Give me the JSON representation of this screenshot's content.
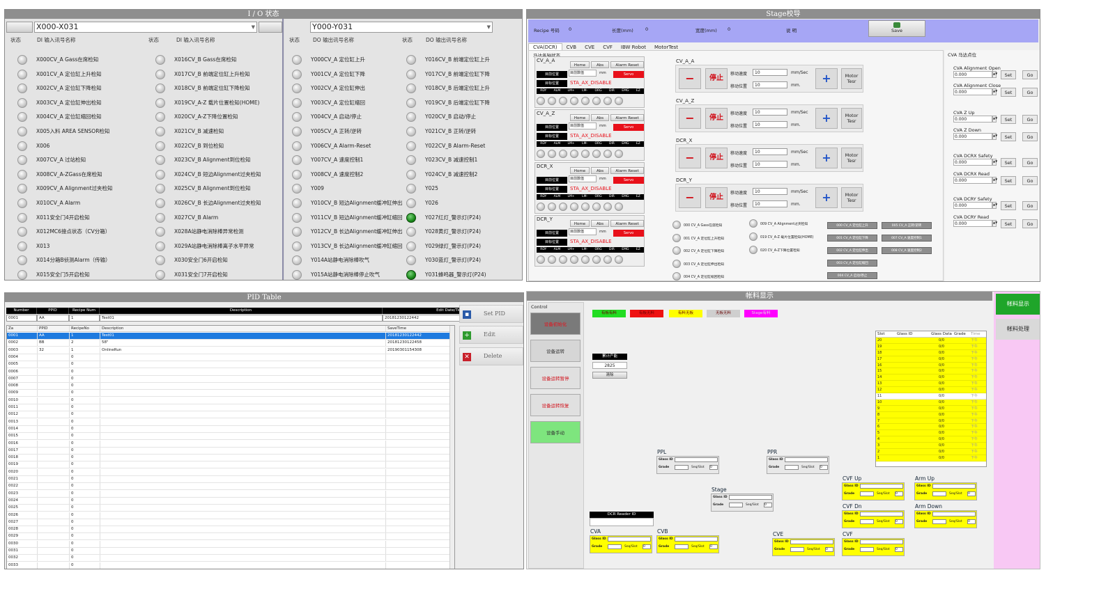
{
  "io": {
    "title": "I / O 状态",
    "di_select": "X000-X031",
    "do_select": "Y000-Y031",
    "h_state": "状态",
    "h_di_name": "DI 输入讯号名称",
    "h_do_name": "DO 输出讯号名称",
    "di_left": [
      "X000CV_A Gass在席检知",
      "X001CV_A 定位缸上升检知",
      "X002CV_A 定位缸下降检知",
      "X003CV_A 定位缸伸出检知",
      "X004CV_A 定位缸缩回检知",
      "X005入料 AREA SENSOR检知",
      "X006",
      "X007CV_A 过站检知",
      "X008CV_A-ZGass在席检知",
      "X009CV_A Alignment过夹检知",
      "X010CV_A Alarm",
      "X011安全门4开启检知",
      "X012MC6接点状态（CV分箱）",
      "X013",
      "X014分箱B侦测Alarm（传输）",
      "X015安全门5开启检知"
    ],
    "di_right": [
      "X016CV_B Gass在席检知",
      "X017CV_B 前端定位缸上升检知",
      "X018CV_B 前端定位缸下降检知",
      "X019CV_A-Z 载片位置检知(HOME)",
      "X020CV_A-Z下降位置检知",
      "X021CV_B 减速检知",
      "X022CV_B 到位检知",
      "X023CV_B Alignment到位检知",
      "X024CV_B 短边Alignment过夹检知",
      "X025CV_B Alignment到位检知",
      "X026CV_B 长边Alignment过夹检知",
      "X027CV_B Alarm",
      "X028A站静电消除棒异常检测",
      "X029A站静电消除棒离子水平异常",
      "X030安全门6开启检知",
      "X031安全门7开启检知"
    ],
    "do_left": [
      "Y000CV_A 定位缸上升",
      "Y001CV_A 定位缸下降",
      "Y002CV_A 定位缸伸出",
      "Y003CV_A 定位缸缩回",
      "Y004CV_A 启动/停止",
      "Y005CV_A 正转/逆转",
      "Y006CV_A Alarm-Reset",
      "Y007CV_A 速度控制1",
      "Y008CV_A 速度控制2",
      "Y009",
      "Y010CV_B 短边Alignment缓冲缸伸出",
      "Y011CV_B 短边Alignment缓冲缸缩回",
      "Y012CV_B 长边Alignment缓冲缸伸出",
      "Y013CV_B 长边Alignment缓冲缸缩回",
      "Y014A站静电消除棒吹气",
      "Y015A站静电消除棒停止吹气"
    ],
    "do_right": [
      "Y016CV_B 前端定位缸上升",
      "Y017CV_B 前端定位缸下降",
      "Y018CV_B 后端定位缸上升",
      "Y019CV_B 后端定位缸下降",
      "Y020CV_B 启动/停止",
      "Y021CV_B 正转/逆转",
      "Y022CV_B Alarm-Reset",
      "Y023CV_B 减速控制1",
      "Y024CV_B 减速控制2",
      "Y025",
      "Y026",
      "Y027红灯_警示灯(P24)",
      "Y028黄灯_警示灯(P24)",
      "Y029绿灯_警示灯(P24)",
      "Y030蓝灯_警示灯(P24)",
      "Y031蜂鸣器_警示灯(P24)"
    ]
  },
  "stage": {
    "title": "Stage校导",
    "recipe_label": "Recipe 号码",
    "recipe_val": "0",
    "len_label": "长度(mm)",
    "len_val": "0",
    "wid_label": "宽度(mm)",
    "wid_val": "0",
    "note_label": "说 明",
    "save": "Save",
    "tabs": [
      "CVA(DCR)",
      "CVB",
      "CVE",
      "CVF",
      "IBW Robot",
      "MotorTest"
    ],
    "axis_group": "马达各轴状态",
    "axes": [
      {
        "name": "CV_A_A"
      },
      {
        "name": "CV_A_Z"
      },
      {
        "name": "DCR_X"
      },
      {
        "name": "DCR_Y"
      }
    ],
    "home": "Home",
    "abs": "Abs",
    "alarm_reset": "Alarm Reset",
    "cur_pos": "目前位置",
    "cmd": "目标位置",
    "pos_val": "0",
    "mm": "mm",
    "servo": "Servo",
    "disable": "STA_AX_DISABLE",
    "jump": "目前数值",
    "strip": [
      "RDY",
      "ALM",
      "LM+",
      "LM-",
      "ORG",
      "DIR",
      "EMG",
      "EZ"
    ],
    "moves": [
      {
        "name": "CV_A_A"
      },
      {
        "name": "CV_A_Z"
      },
      {
        "name": "DCR_X"
      },
      {
        "name": "DCR_Y"
      }
    ],
    "speed_lbl": "移动速度",
    "dist_lbl": "移动位置",
    "speed_val": "10",
    "dist_val": "10",
    "unit_speed": "mm/Sec",
    "unit_dist": "mm.",
    "stop": "停止",
    "motor_test": "Motor Tesr",
    "sig_left": [
      "000 CV_A Gass在席检知",
      "001 CV_A 定位缸上升检知",
      "002 CV_A 定位缸下降检知",
      "003 CV_A 定位缸伸出检知",
      "004 CV_A 定位缸缩回检知"
    ],
    "sig_mid": [
      "009 CV_A Alignment过夹检知",
      "019 CV_A-Z 载片位置检知(HOME)",
      "020 CV_A-Z下降位置检知"
    ],
    "btn_a": [
      "000 CV_A 定位缸上升",
      "001 CV_A 定位缸下降",
      "002 CV_A 定位缸伸出",
      "003 CV_A 定位缸缩回",
      "004 CV_A 启动/停止"
    ],
    "btn_b": [
      "005 CV_A 正转/逆转",
      "007 CV_A 速度控制1",
      "008 CV_A 速度控制2"
    ],
    "cva_title": "CVA 马达点位",
    "points": [
      {
        "label": "CVA Alignment Open",
        "val": "0.000"
      },
      {
        "label": "CVA Alignment Close",
        "val": "0.000"
      },
      {
        "label": "CVA Z Up",
        "val": "0.000"
      },
      {
        "label": "CVA Z Down",
        "val": "0.000"
      },
      {
        "label": "CVA DCRX Safety",
        "val": "0.000"
      },
      {
        "label": "CVA DCRX Read",
        "val": "0.000"
      },
      {
        "label": "CVA DCRY Safety",
        "val": "0.000"
      },
      {
        "label": "CVA DCRY Read",
        "val": "0.000"
      }
    ],
    "set": "Set",
    "go": "Go"
  },
  "pid": {
    "title": "PID Table",
    "hdr": [
      "Number",
      "PPID",
      "Recipe Num",
      "Description",
      "Edit Date/Time"
    ],
    "inputs": [
      "0001",
      "AA",
      "1",
      "Test01",
      "20181230122442"
    ],
    "cols": [
      "Za",
      "PPID",
      "RecipeNo",
      "Description",
      "SaveTime"
    ],
    "rows": [
      [
        "0001",
        "AA",
        "1",
        "Test01",
        "20181230122442"
      ],
      [
        "0002",
        "BB",
        "2",
        "58\"",
        "20181230122458"
      ],
      [
        "0003",
        "32",
        "1",
        "OnlineRun",
        "20190301154308"
      ],
      [
        "0004",
        "",
        "0",
        "",
        ""
      ],
      [
        "0005",
        "",
        "0",
        "",
        ""
      ],
      [
        "0006",
        "",
        "0",
        "",
        ""
      ],
      [
        "0007",
        "",
        "0",
        "",
        ""
      ],
      [
        "0008",
        "",
        "0",
        "",
        ""
      ],
      [
        "0009",
        "",
        "0",
        "",
        ""
      ],
      [
        "0010",
        "",
        "0",
        "",
        ""
      ],
      [
        "0011",
        "",
        "0",
        "",
        ""
      ],
      [
        "0012",
        "",
        "0",
        "",
        ""
      ],
      [
        "0013",
        "",
        "0",
        "",
        ""
      ],
      [
        "0014",
        "",
        "0",
        "",
        ""
      ],
      [
        "0015",
        "",
        "0",
        "",
        ""
      ],
      [
        "0016",
        "",
        "0",
        "",
        ""
      ],
      [
        "0017",
        "",
        "0",
        "",
        ""
      ],
      [
        "0018",
        "",
        "0",
        "",
        ""
      ],
      [
        "0019",
        "",
        "0",
        "",
        ""
      ],
      [
        "0020",
        "",
        "0",
        "",
        ""
      ],
      [
        "0021",
        "",
        "0",
        "",
        ""
      ],
      [
        "0022",
        "",
        "0",
        "",
        ""
      ],
      [
        "0023",
        "",
        "0",
        "",
        ""
      ],
      [
        "0024",
        "",
        "0",
        "",
        ""
      ],
      [
        "0025",
        "",
        "0",
        "",
        ""
      ],
      [
        "0026",
        "",
        "0",
        "",
        ""
      ],
      [
        "0027",
        "",
        "0",
        "",
        ""
      ],
      [
        "0028",
        "",
        "0",
        "",
        ""
      ],
      [
        "0029",
        "",
        "0",
        "",
        ""
      ],
      [
        "0030",
        "",
        "0",
        "",
        ""
      ],
      [
        "0031",
        "",
        "0",
        "",
        ""
      ],
      [
        "0032",
        "",
        "0",
        "",
        ""
      ],
      [
        "0033",
        "",
        "0",
        "",
        ""
      ]
    ],
    "set_pid": "Set PID",
    "edit": "Edit",
    "delete": "Delete"
  },
  "acct": {
    "title": "帐料显示",
    "control": "Control",
    "ctl": [
      "设备初始化",
      "设备运转",
      "设备运转暂停",
      "设备运转恢复",
      "设备手动"
    ],
    "legend": [
      "有板有料",
      "有板无料",
      "有料无板",
      "无板无料",
      "Stage有料"
    ],
    "counter_label": "累计产能",
    "counter_val": "2825",
    "clear": "清除",
    "slot_hdr": [
      "Slot",
      "Glass ID",
      "Glass Data",
      "Grade",
      "Time"
    ],
    "slots": [
      "20",
      "19",
      "18",
      "17",
      "16",
      "15",
      "14",
      "13",
      "12",
      "11",
      "10",
      "9",
      "8",
      "7",
      "6",
      "5",
      "4",
      "3",
      "2",
      "1"
    ],
    "slot_data": "0/0",
    "slot_time": "下午",
    "dcr": "DCR Reader ID",
    "glass_lbl": "Glass ID",
    "grade_lbl": "Grade",
    "seq_lbl": "Seq/Slot",
    "seq_val": "0",
    "cards": [
      "PPL",
      "PPR",
      "Stage",
      "CVF Up",
      "Arm Up",
      "CVF Dn",
      "Arm Down",
      "CVA",
      "CVB",
      "CVE",
      "CVF"
    ],
    "side": [
      "帐料显示",
      "帐料处理"
    ]
  }
}
